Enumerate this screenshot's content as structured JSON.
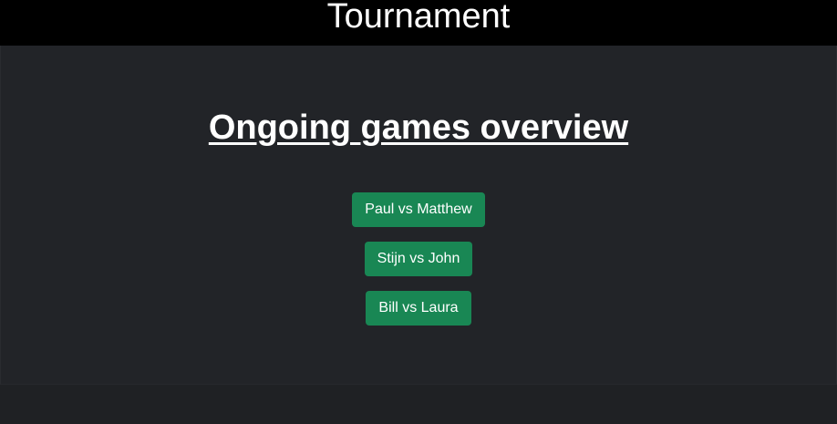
{
  "header": {
    "title": "Tournament"
  },
  "main": {
    "heading": "Ongoing games overview",
    "games": [
      {
        "label": "Paul vs Matthew"
      },
      {
        "label": "Stijn vs John"
      },
      {
        "label": "Bill vs Laura"
      }
    ]
  },
  "colors": {
    "header_bg": "#000000",
    "page_bg": "#222428",
    "button_bg": "#198754",
    "text": "#ffffff"
  }
}
